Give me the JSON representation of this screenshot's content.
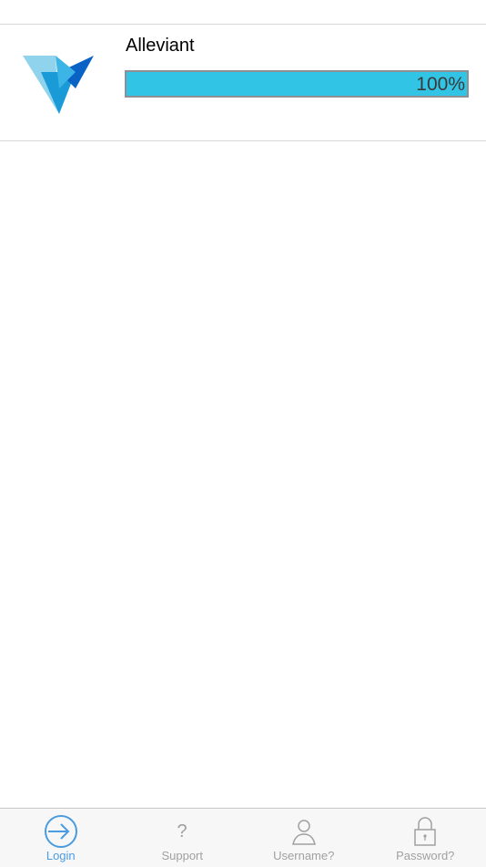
{
  "app": {
    "name": "Alleviant",
    "progress_text": "100%",
    "progress_value": 1.0,
    "logo_icon": "alleviant-logo"
  },
  "colors": {
    "progress_fill": "#32c4e4",
    "tab_active": "#4a9be0",
    "tab_inactive": "#a0a0a0"
  },
  "tabbar": {
    "tabs": [
      {
        "label": "Login",
        "icon": "login-arrow-icon",
        "active": true
      },
      {
        "label": "Support",
        "icon": "question-icon",
        "active": false
      },
      {
        "label": "Username?",
        "icon": "user-icon",
        "active": false
      },
      {
        "label": "Password?",
        "icon": "lock-icon",
        "active": false
      }
    ]
  }
}
